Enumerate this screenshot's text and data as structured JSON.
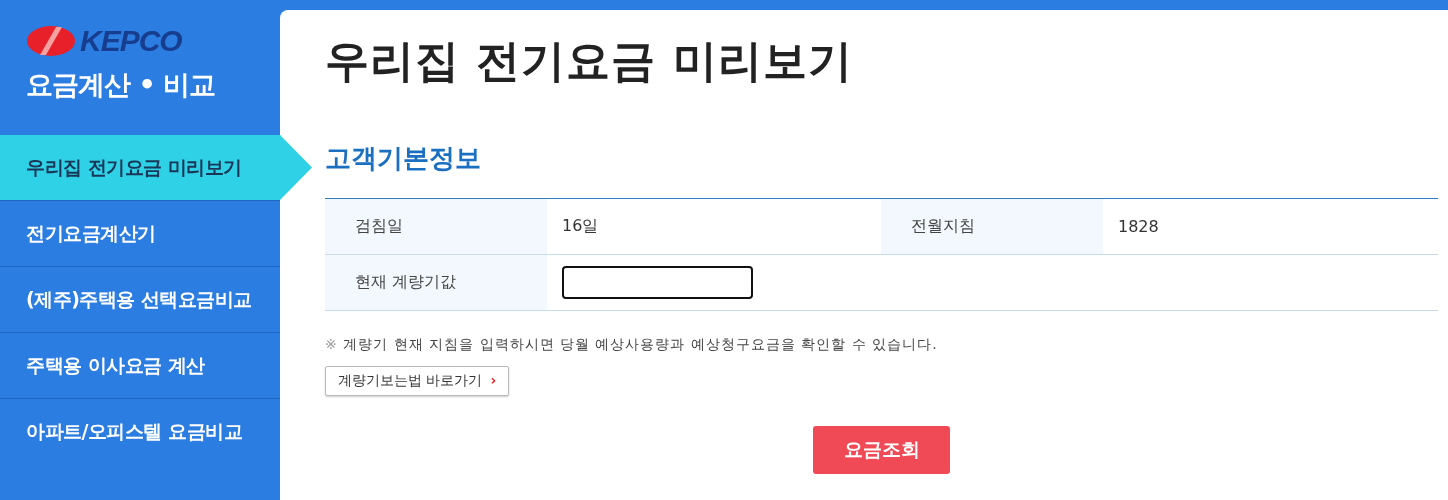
{
  "sidebar": {
    "brand": "KEPCO",
    "subtitle": "요금계산 • 비교",
    "items": [
      {
        "label": "우리집 전기요금 미리보기",
        "selected": true
      },
      {
        "label": "전기요금계산기",
        "selected": false
      },
      {
        "label": "(제주)주택용 선택요금비교",
        "selected": false
      },
      {
        "label": "주택용 이사요금 계산",
        "selected": false
      },
      {
        "label": "아파트/오피스텔 요금비교",
        "selected": false
      }
    ]
  },
  "main": {
    "title": "우리집 전기요금 미리보기",
    "section_title": "고객기본정보",
    "fields": [
      {
        "label": "검침일",
        "value": "16일"
      },
      {
        "label": "전월지침",
        "value": "1828"
      }
    ],
    "meter_field": {
      "label": "현재 계량기값"
    },
    "note_mark": "※",
    "note": "계량기 현재 지침을 입력하시면 당월 예상사용량과 예상청구요금을 확인할 수 있습니다.",
    "guide_link": {
      "label": "계량기보는법 바로가기",
      "arrow": "›"
    },
    "submit_button": "요금조회"
  }
}
